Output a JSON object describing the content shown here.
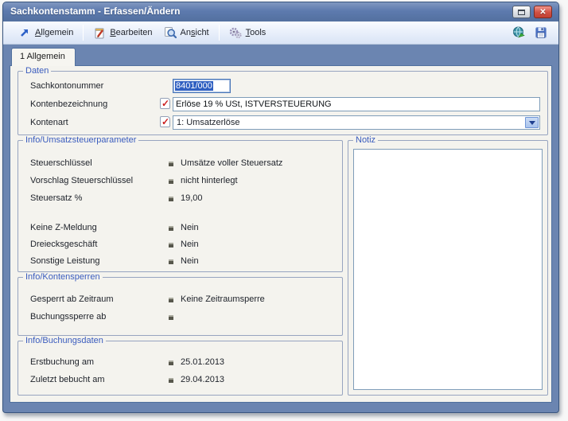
{
  "window": {
    "title": "Sachkontenstamm - Erfassen/Ändern",
    "controls": {
      "restore": "restore-icon",
      "close_glyph": "✕"
    }
  },
  "toolbar": {
    "items": [
      {
        "pre": "",
        "key": "A",
        "post": "llgemein",
        "icon": "arrow-ne-icon"
      },
      {
        "pre": "",
        "key": "B",
        "post": "earbeiten",
        "icon": "edit-icon"
      },
      {
        "pre": "An",
        "key": "s",
        "post": "icht",
        "icon": "magnifier-icon"
      },
      {
        "pre": "",
        "key": "T",
        "post": "ools",
        "icon": "gears-icon"
      }
    ],
    "right_icons": [
      "globe-icon",
      "save-icon"
    ]
  },
  "tabs": [
    {
      "label": "1 Allgemein",
      "active": true
    }
  ],
  "groups": {
    "daten": {
      "title": "Daten",
      "fields": [
        {
          "label": "Sachkontonummer",
          "value": "8401/000",
          "selected": true
        },
        {
          "label": "Kontenbezeichnung",
          "value": "Erlöse 19 % USt, ISTVERSTEUERUNG",
          "confirmed": true
        },
        {
          "label": "Kontenart",
          "value": "1: Umsatzerlöse",
          "confirmed": true,
          "type": "dropdown"
        }
      ]
    },
    "umsatzsteuer": {
      "title": "Info/Umsatzsteuerparameter",
      "rows": [
        {
          "label": "Steuerschlüssel",
          "value": "Umsätze voller Steuersatz"
        },
        {
          "label": "Vorschlag Steuerschlüssel",
          "value": "nicht hinterlegt"
        },
        {
          "label": "Steuersatz %",
          "value": "19,00"
        },
        {
          "label": "Keine Z-Meldung",
          "value": "Nein"
        },
        {
          "label": "Dreiecksgeschäft",
          "value": "Nein"
        },
        {
          "label": "Sonstige Leistung",
          "value": "Nein"
        }
      ]
    },
    "notiz": {
      "title": "Notiz",
      "value": ""
    },
    "kontensperren": {
      "title": "Info/Kontensperren",
      "rows": [
        {
          "label": "Gesperrt ab Zeitraum",
          "value": "Keine Zeitraumsperre"
        },
        {
          "label": "Buchungssperre ab",
          "value": ""
        }
      ]
    },
    "buchungsdaten": {
      "title": "Info/Buchungsdaten",
      "rows": [
        {
          "label": "Erstbuchung am",
          "value": "25.01.2013"
        },
        {
          "label": "Zuletzt bebucht am",
          "value": "29.04.2013"
        }
      ]
    }
  },
  "colors": {
    "titlebar": "#5d7aae",
    "frame": "#6b85b1",
    "panel_bg": "#f4f3ee",
    "group_title": "#3a5cbe",
    "selection_bg": "#2f5fc1",
    "check_red": "#cc1f1f",
    "close_button": "#d05043"
  }
}
